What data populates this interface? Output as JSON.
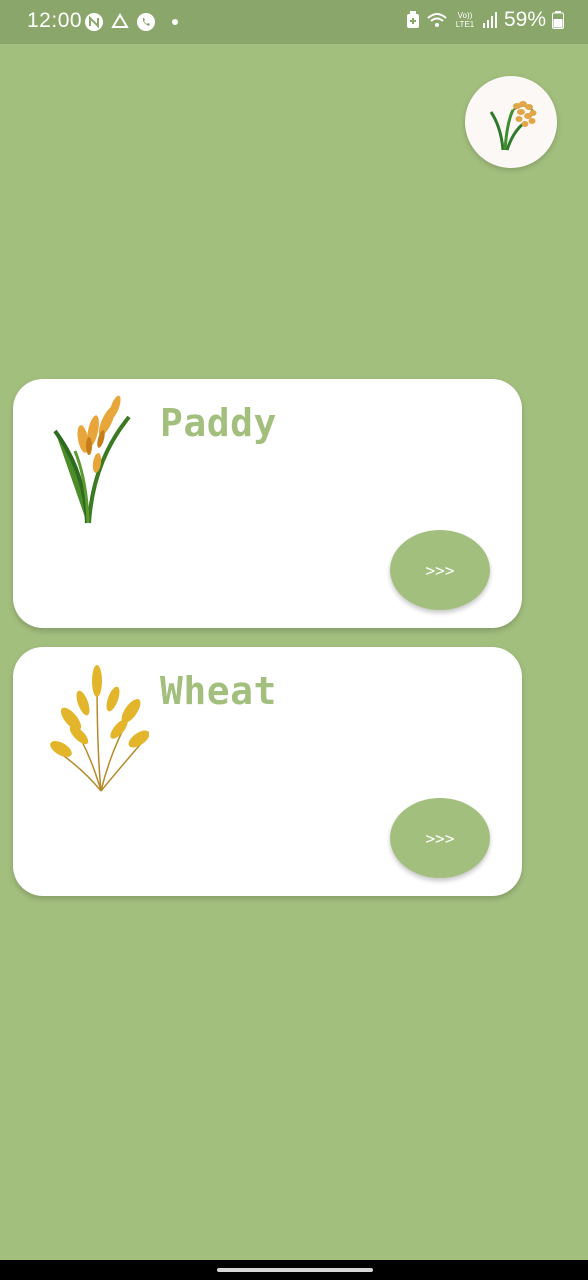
{
  "status_bar": {
    "time": "12:00",
    "battery": "59%",
    "network_label": "Vo)) LTE1",
    "icons": [
      "n-app-icon",
      "drive-icon",
      "phone-icon",
      "notification-dot",
      "battery-saver-icon",
      "wifi-icon",
      "signal-icon",
      "battery-icon"
    ]
  },
  "header": {
    "avatar_icon": "rice-plant-icon"
  },
  "crops": [
    {
      "name": "Paddy",
      "image": "paddy-plant-image",
      "button_label": ">>>"
    },
    {
      "name": "Wheat",
      "image": "wheat-plant-image",
      "button_label": ">>>"
    }
  ],
  "colors": {
    "background": "#a3bf7e",
    "status_bar": "#8aa66a",
    "card": "#ffffff",
    "accent": "#a3bf7e"
  }
}
